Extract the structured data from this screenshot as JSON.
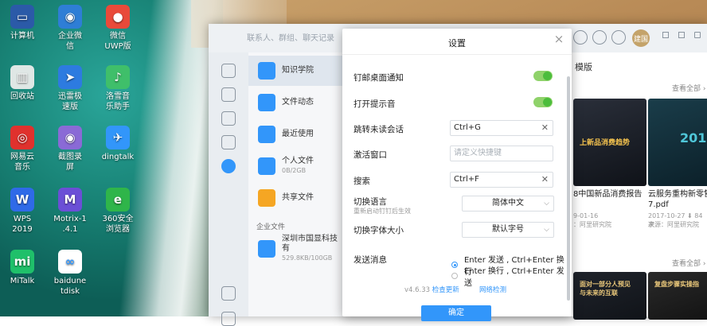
{
  "desktop": {
    "icons": [
      {
        "label": "计算机",
        "color": "#2b5aa8",
        "glyph": "▭"
      },
      {
        "label": "企业微\n信",
        "color": "#2e7ed6",
        "glyph": "◉"
      },
      {
        "label": "微信\nUWP版",
        "color": "#e94a3a",
        "glyph": "●"
      },
      {
        "label": "回收站",
        "color": "#dfe7e5",
        "glyph": "▥"
      },
      {
        "label": "迅雷极\n速版",
        "color": "#2d7be0",
        "glyph": "➤"
      },
      {
        "label": "洛雪音\n乐助手",
        "color": "#3fbf6a",
        "glyph": "♪"
      },
      {
        "label": "网易云\n音乐",
        "color": "#e0312d",
        "glyph": "◎"
      },
      {
        "label": "截图录\n屏",
        "color": "#8a6ad6",
        "glyph": "◉"
      },
      {
        "label": "dingtalk",
        "color": "#3296fa",
        "glyph": "✈"
      },
      {
        "label": "WPS\n2019",
        "color": "#2f6ae8",
        "glyph": "W"
      },
      {
        "label": "Motrix-1\n.4.1",
        "color": "#6b4fd6",
        "glyph": "M"
      },
      {
        "label": "360安全\n浏览器",
        "color": "#2fb54a",
        "glyph": "e"
      },
      {
        "label": "MiTalk",
        "color": "#1fc06a",
        "glyph": "mi"
      },
      {
        "label": "baidune\ntdisk",
        "color": "#ffffff",
        "glyph": "∞"
      }
    ]
  },
  "dingtalk": {
    "search_placeholder": "联系人、群组、聊天记录",
    "avatar_text": "建国",
    "list": [
      {
        "label": "知识学院",
        "sub": ""
      },
      {
        "label": "文件动态",
        "sub": ""
      },
      {
        "label": "最近使用",
        "sub": ""
      },
      {
        "label": "个人文件",
        "sub": "0B/2GB"
      },
      {
        "label": "共享文件",
        "sub": ""
      }
    ],
    "enterprise_section": "企业文件",
    "enterprise_item": {
      "label": "深圳市国显科技有",
      "sub": "529.8KB/100GB"
    },
    "tab_label": "模版",
    "view_all_1": "查看全部 ›",
    "view_all_2": "查看全部 ›",
    "docs": [
      {
        "title": "8中国新品消费报告",
        "date": "9-01-16",
        "source": "：阿里研究院",
        "cover_text": "上新品消费趋势"
      },
      {
        "title": "云服务重构新零售\n7.pdf",
        "date": "2017-10-27 ⬇ 84次",
        "source": "来源：阿里研究院",
        "cover_text": "2017"
      }
    ],
    "bottom_docs": [
      {
        "cover_text": "面对一部分人预见\n与未来的互联"
      },
      {
        "cover_text": "复盘步骤实操指"
      }
    ]
  },
  "settings": {
    "title": "设置",
    "close": "×",
    "rows": [
      {
        "label": "钉邮桌面通知",
        "type": "toggle",
        "on": true
      },
      {
        "label": "打开提示音",
        "type": "toggle",
        "on": true
      },
      {
        "label": "跳转未读会话",
        "type": "hotkey",
        "value": "Ctrl+G"
      },
      {
        "label": "激活窗口",
        "type": "hotkey",
        "placeholder": "请定义快捷键"
      },
      {
        "label": "搜索",
        "type": "hotkey",
        "value": "Ctrl+F"
      }
    ],
    "language": {
      "label": "切换语言",
      "sub": "重新启动钉钉后生效",
      "value": "简体中文"
    },
    "font_size": {
      "label": "切换字体大小",
      "value": "默认字号"
    },
    "send": {
      "label": "发送消息",
      "options": [
        "Enter 发送 , Ctrl+Enter 换行",
        "Enter 换行 , Ctrl+Enter 发送"
      ],
      "selected": 0
    },
    "version": "v4.6.33",
    "check_update": "检查更新",
    "network_check": "网络检测",
    "confirm": "确定"
  }
}
